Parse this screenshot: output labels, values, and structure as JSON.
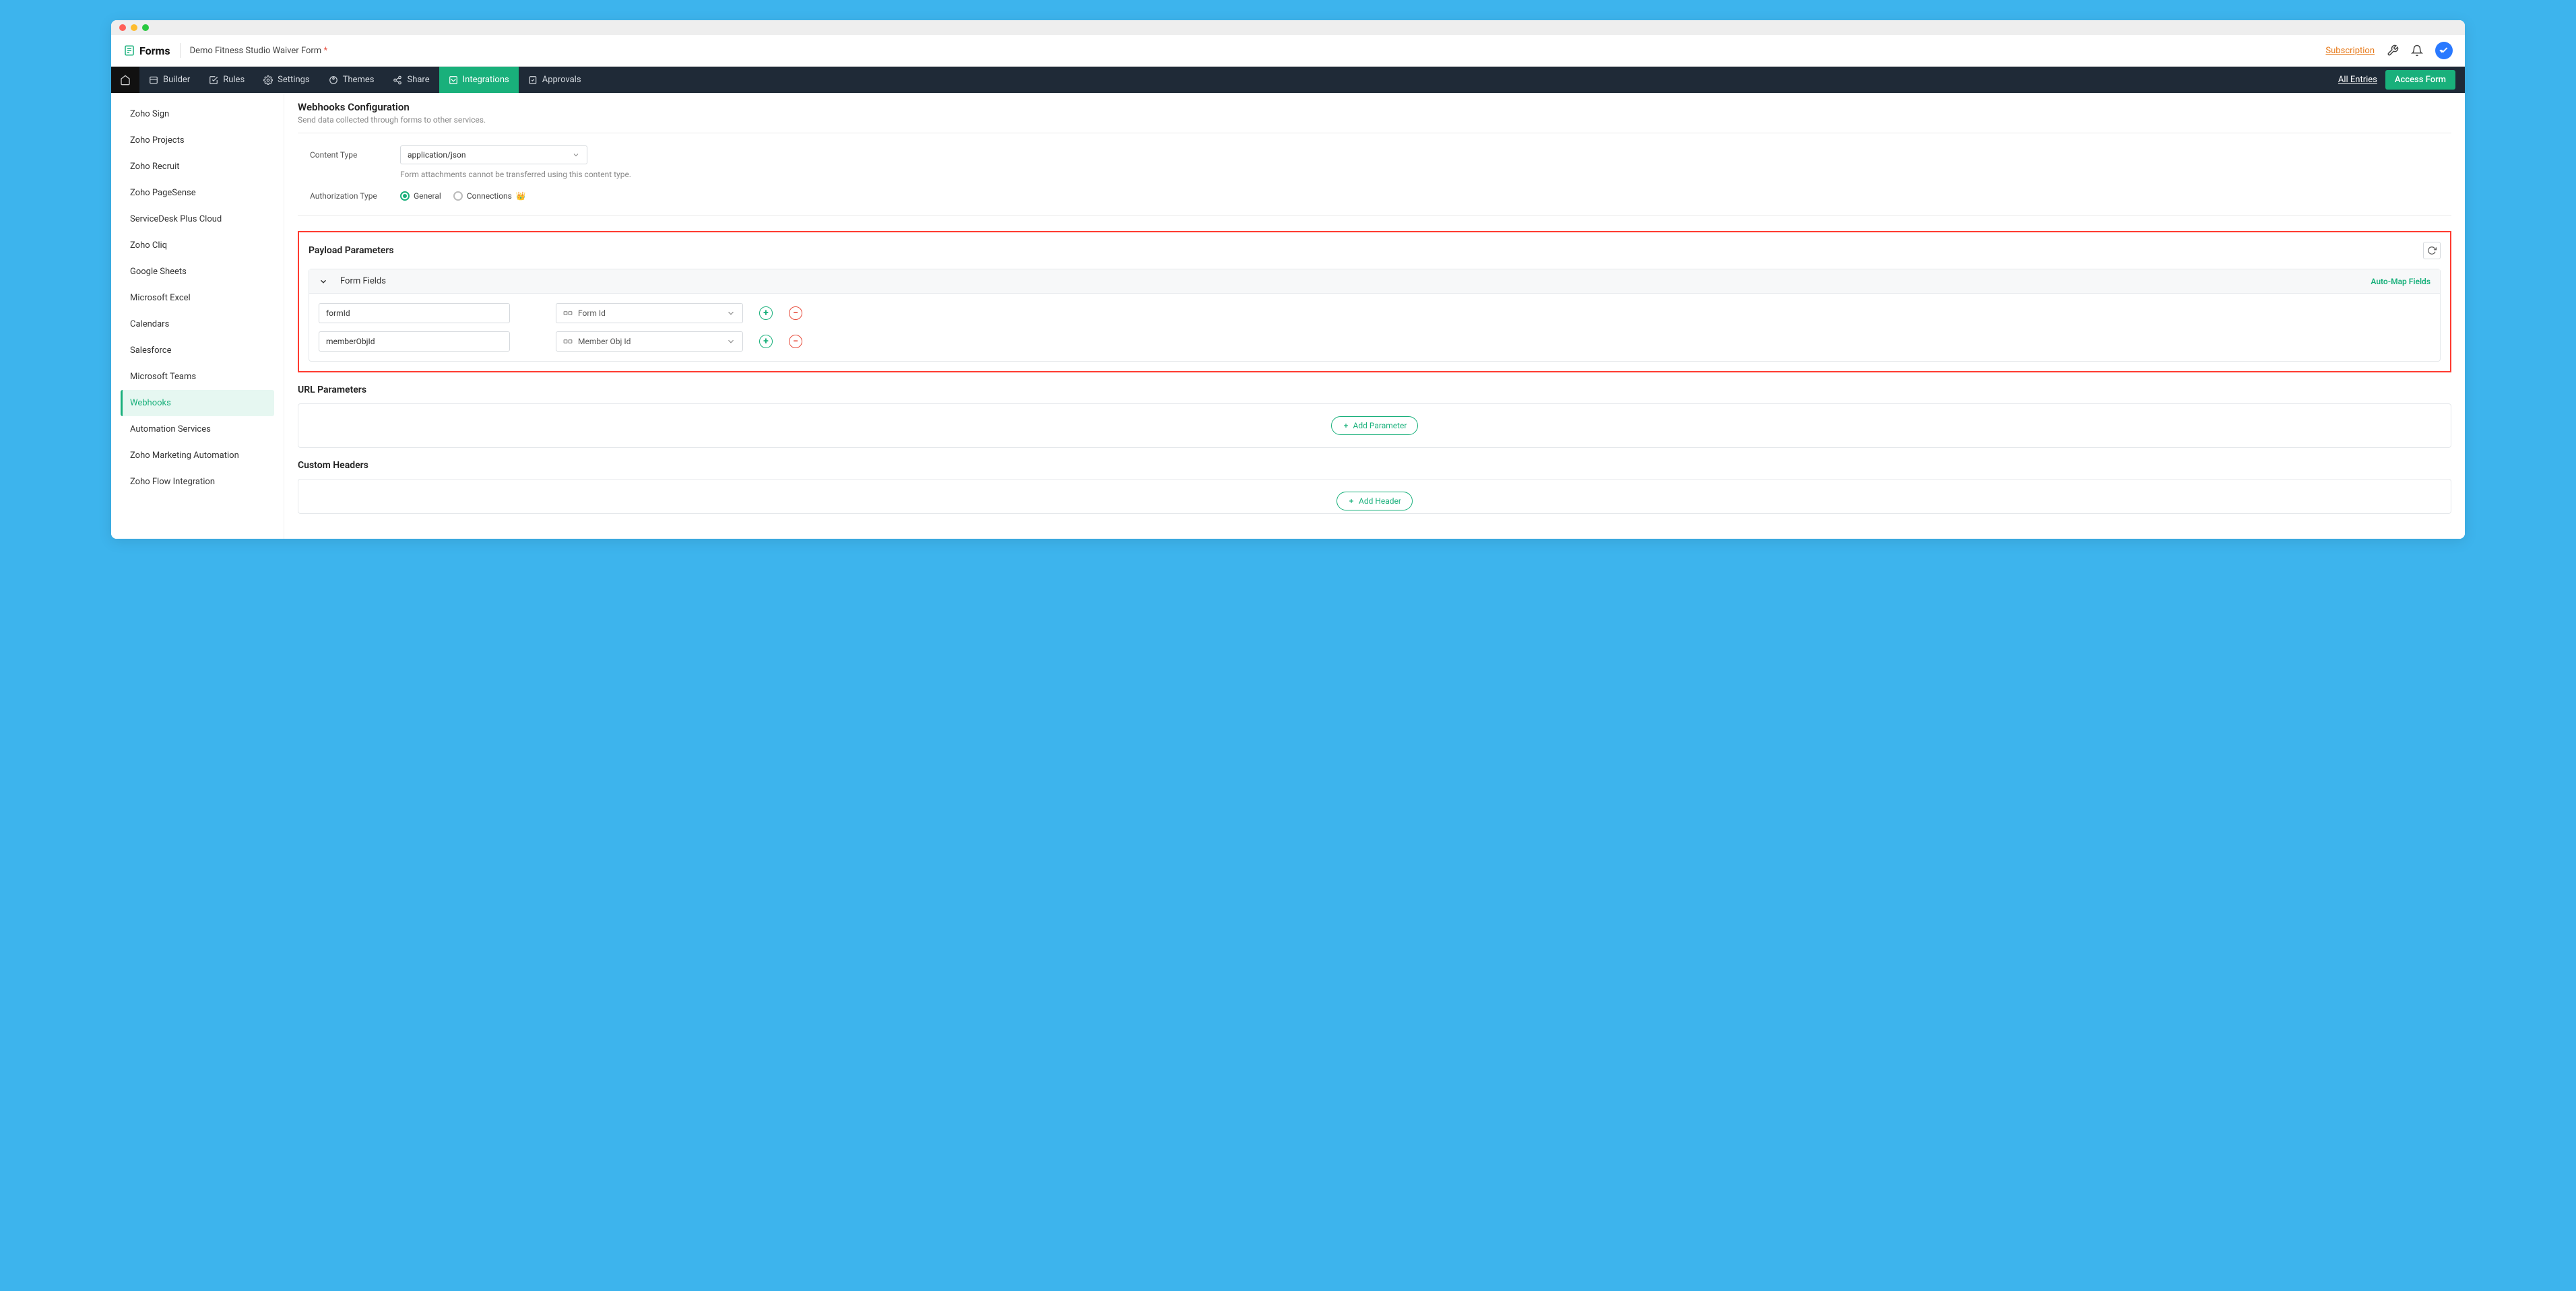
{
  "header": {
    "app_name": "Forms",
    "form_title": "Demo Fitness Studio Waiver Form",
    "subscription": "Subscription"
  },
  "nav": {
    "builder": "Builder",
    "rules": "Rules",
    "settings": "Settings",
    "themes": "Themes",
    "share": "Share",
    "integrations": "Integrations",
    "approvals": "Approvals",
    "all_entries": "All Entries",
    "access_form": "Access Form"
  },
  "sidebar": {
    "items": [
      "Zoho Sign",
      "Zoho Projects",
      "Zoho Recruit",
      "Zoho PageSense",
      "ServiceDesk Plus Cloud",
      "Zoho Cliq",
      "Google Sheets",
      "Microsoft Excel",
      "Calendars",
      "Salesforce",
      "Microsoft Teams",
      "Webhooks",
      "Automation Services",
      "Zoho Marketing Automation",
      "Zoho Flow Integration"
    ],
    "active_index": 11
  },
  "page": {
    "title": "Webhooks Configuration",
    "subtitle": "Send data collected through forms to other services.",
    "content_type_label": "Content Type",
    "content_type_value": "application/json",
    "content_type_hint": "Form attachments cannot be transferred using this content type.",
    "auth_label": "Authorization Type",
    "auth_general": "General",
    "auth_connections": "Connections",
    "payload_title": "Payload Parameters",
    "form_fields_label": "Form Fields",
    "auto_map": "Auto-Map Fields",
    "params": [
      {
        "key": "formId",
        "field": "Form Id"
      },
      {
        "key": "memberObjId",
        "field": "Member Obj Id"
      }
    ],
    "url_params_title": "URL Parameters",
    "add_parameter": "Add Parameter",
    "custom_headers_title": "Custom Headers",
    "add_header": "Add Header"
  }
}
